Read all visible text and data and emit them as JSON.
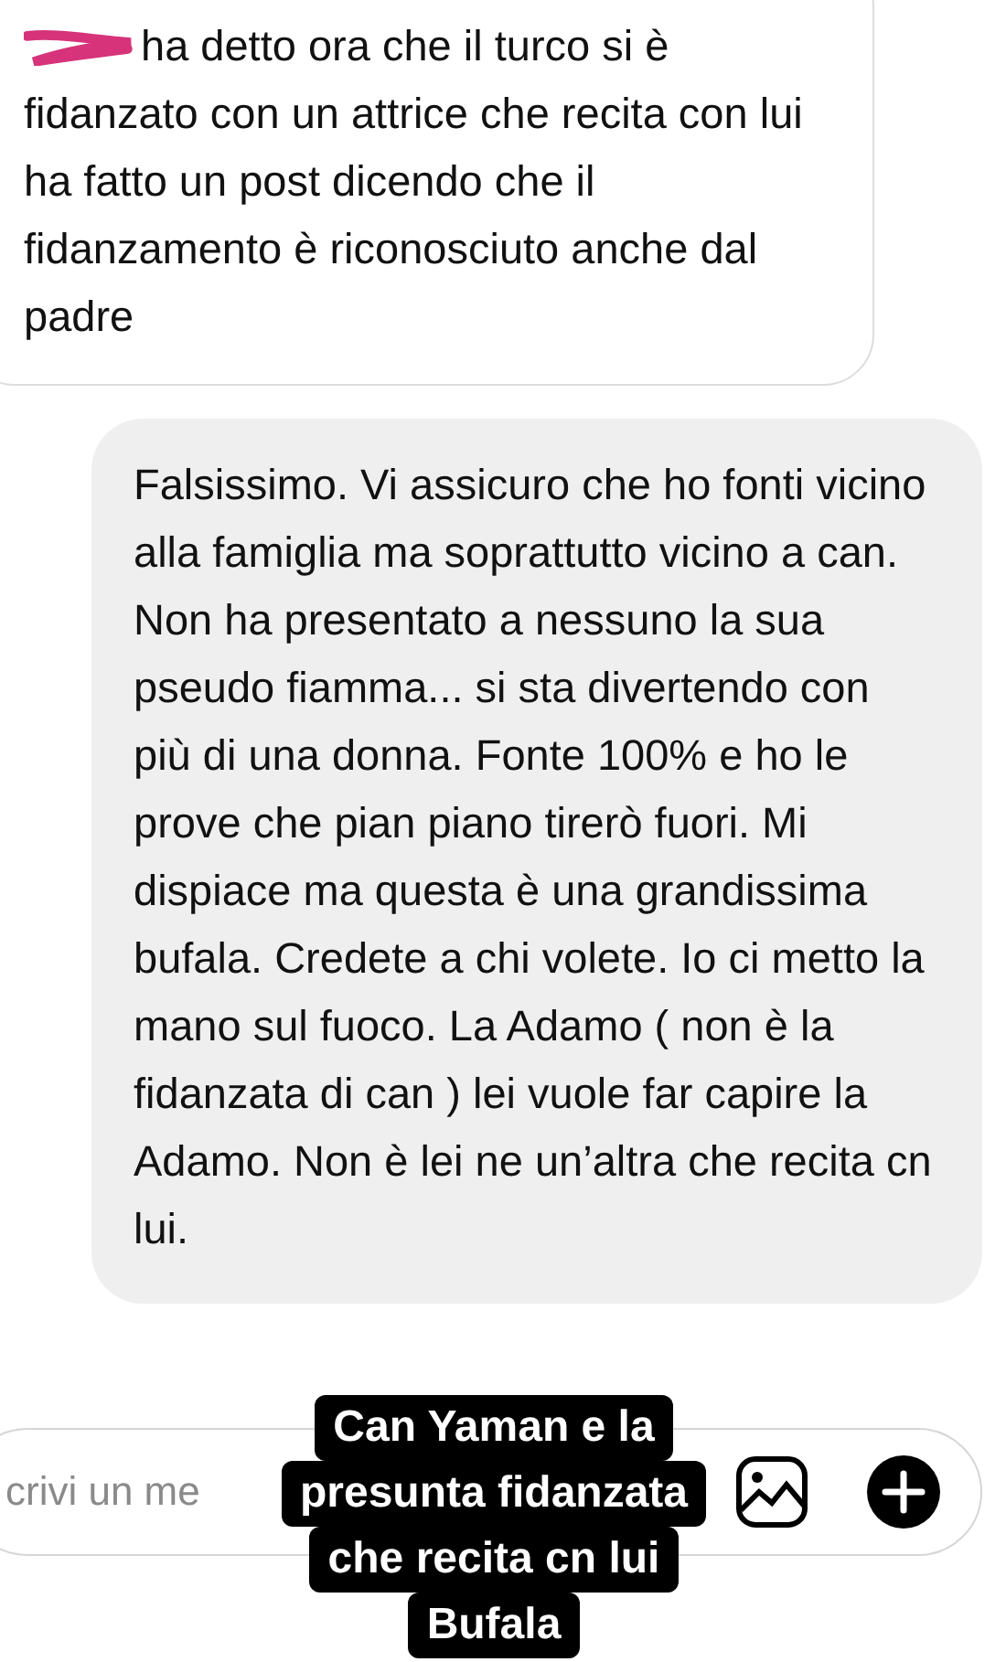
{
  "messages": [
    {
      "kind": "received",
      "redacted": true,
      "text": "ha detto ora che il turco si è fidanzato con un attrice che recita con lui ha fatto un post dicendo che il fidanzamento è riconosciuto anche dal padre"
    },
    {
      "kind": "sent",
      "text": "Falsissimo. Vi assicuro che ho fonti vicino alla famiglia ma soprattutto vicino a can. Non ha presentato a nessuno la sua pseudo fiamma... si sta divertendo con più di una donna. Fonte 100% e ho le prove che pian piano tirerò fuori. Mi dispiace ma questa è una grandissima bufala. Credete a chi volete. Io ci metto la mano sul fuoco. La Adamo ( non è la fidanzata di can ) lei vuole far capire la Adamo. Non è lei ne un’altra che recita cn lui."
    }
  ],
  "composer": {
    "placeholder": "crivi un me"
  },
  "caption": {
    "lines": [
      "Can Yaman e la",
      "presunta fidanzata",
      "che recita cn lui",
      "Bufala"
    ]
  }
}
